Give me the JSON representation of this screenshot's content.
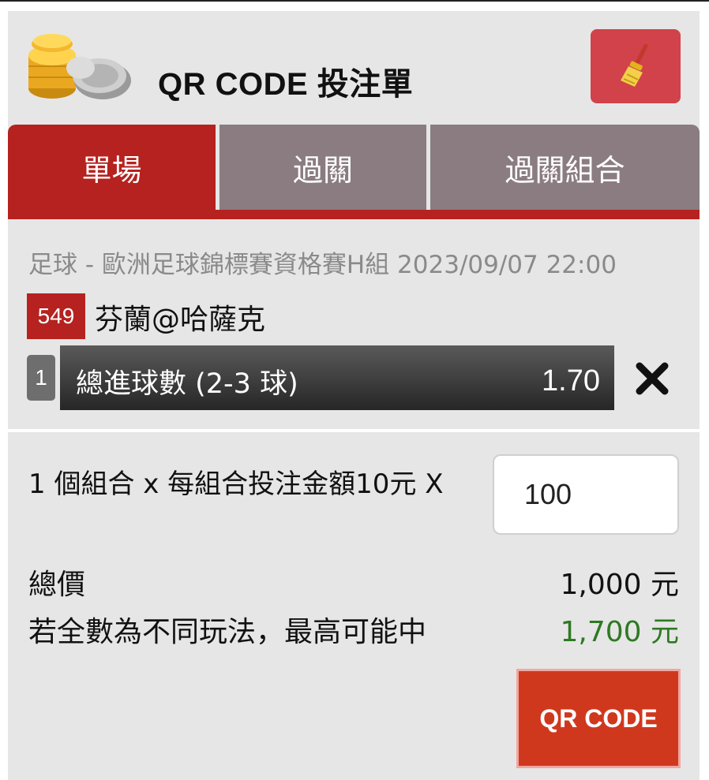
{
  "header": {
    "title": "QR CODE 投注單",
    "logo_icon": "coins-icon",
    "clear_icon": "broom-icon"
  },
  "tabs": [
    {
      "label": "單場",
      "active": true
    },
    {
      "label": "過關",
      "active": false
    },
    {
      "label": "過關組合",
      "active": false
    }
  ],
  "match": {
    "league": "足球 - 歐洲足球錦標賽資格賽H組 2023/09/07 22:00",
    "number": "549",
    "teams": "芬蘭@哈薩克",
    "selection": {
      "index": "1",
      "label": "總進球數 (2-3 球)",
      "odds": "1.70",
      "remove_icon": "close-icon"
    }
  },
  "bet": {
    "calc_text": "1 個組合 x 每組合投注金額10元 X",
    "amount": "100",
    "total_label": "總價",
    "total_value": "1,000 元",
    "max_label": "若全數為不同玩法，最高可能中",
    "max_value": "1,700 元",
    "qr_button": "QR CODE"
  },
  "colors": {
    "accent_red": "#b5221f",
    "tab_inactive": "#8a7c80",
    "clear_button": "#d1424a",
    "qr_button": "#d0381e",
    "win_green": "#2d7a22"
  }
}
